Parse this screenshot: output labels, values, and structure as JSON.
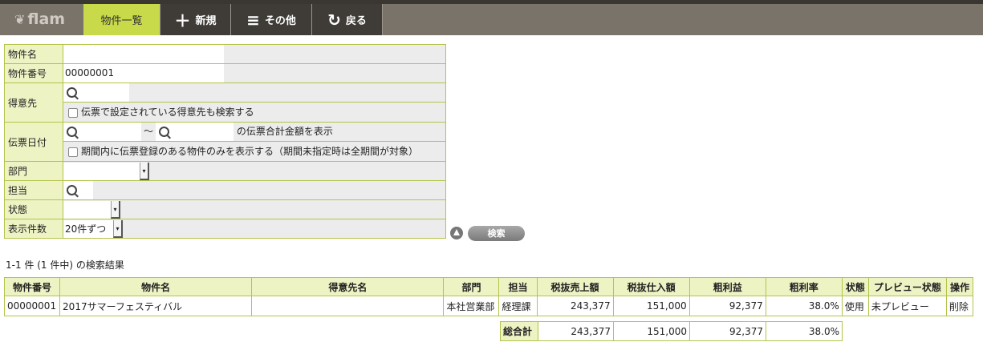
{
  "app": {
    "logo": "flam"
  },
  "nav": [
    {
      "label": "物件一覧",
      "icon": ""
    },
    {
      "label": "新規",
      "icon": "plus-icon"
    },
    {
      "label": "その他",
      "icon": "menu-icon"
    },
    {
      "label": "戻る",
      "icon": "refresh-icon"
    }
  ],
  "search": {
    "labels": {
      "name": "物件名",
      "number": "物件番号",
      "customer": "得意先",
      "date": "伝票日付",
      "dept": "部門",
      "person": "担当",
      "status": "状態",
      "per_page": "表示件数"
    },
    "number_value": "00000001",
    "customer_check": "伝票で設定されている得意先も検索する",
    "date_range_sep": "～",
    "date_suffix": "の伝票合計金額を表示",
    "date_check": "期間内に伝票登録のある物件のみを表示する（期間未指定時は全期間が対象）",
    "per_page_value": "20件ずつ",
    "search_button": "検索"
  },
  "result_count": "1-1 件 (1 件中) の検索結果",
  "table": {
    "headers": [
      "物件番号",
      "物件名",
      "得意先名",
      "部門",
      "担当",
      "税抜売上額",
      "税抜仕入額",
      "粗利益",
      "粗利率",
      "状態",
      "プレビュー状態",
      "操作"
    ],
    "rows": [
      [
        "00000001",
        "2017サマーフェスティバル",
        "",
        "本社営業部",
        "経理課",
        "243,377",
        "151,000",
        "92,377",
        "38.0%",
        "使用",
        "未プレビュー",
        "削除"
      ]
    ]
  },
  "totals": {
    "label": "総合計",
    "values": [
      "243,377",
      "151,000",
      "92,377",
      "38.0%"
    ]
  },
  "colors": {
    "accent": "#c8d94a",
    "header_bg": "#eef3c4",
    "border": "#b5c34a",
    "topbar": "#7a736a"
  }
}
